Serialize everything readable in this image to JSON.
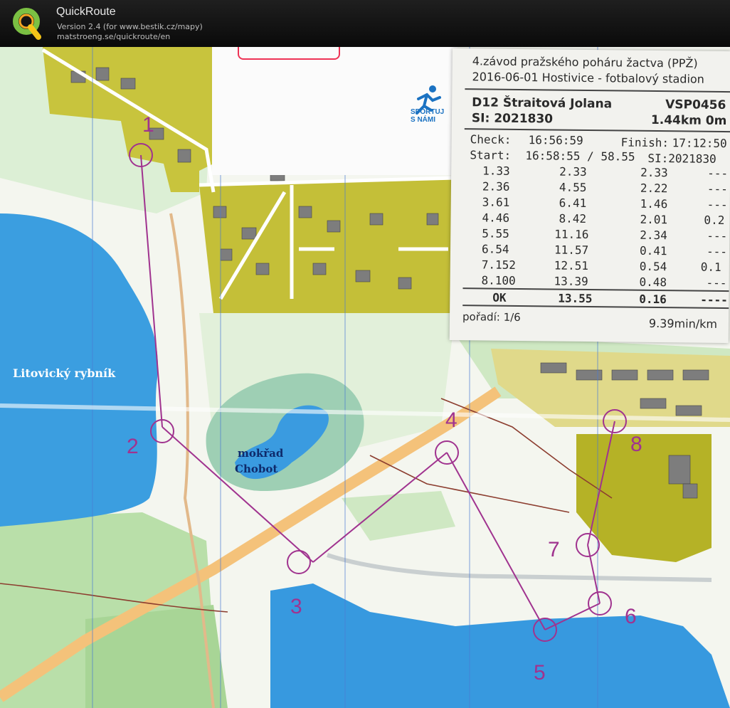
{
  "app": {
    "name": "QuickRoute",
    "version": "Version 2.4  (for www.bestik.cz/mapy)",
    "url": "matstroeng.se/quickroute/en"
  },
  "map": {
    "labels": {
      "lake": "Litovický rybník",
      "marsh_line1": "mokřad",
      "marsh_line2": "Chobot"
    },
    "controls": [
      "1",
      "2",
      "3",
      "4",
      "5",
      "6",
      "7",
      "8"
    ],
    "paper_logo": {
      "line1": "SPORTUJ",
      "line2": "S NÁMI"
    }
  },
  "receipt": {
    "event_line1": "4.závod pražského poháru žactva (PPŽ)",
    "event_line2": "2016-06-01 Hostivice - fotbalový stadion",
    "runner": "D12 Štraitová Jolana",
    "club": "VSP0456",
    "si": "SI: 2021830",
    "course": "1.44km 0m",
    "check_label": "Check:",
    "check_time": "16:56:59",
    "finish_label": "Finish:",
    "finish_time": "17:12:50",
    "start_label": "Start:",
    "start_time": "16:58:55 / 58.55",
    "start_si": "SI:2021830",
    "splits": [
      {
        "ctrl": "1.33",
        "cum": "2.33",
        "leg": "2.33",
        "extra": "---"
      },
      {
        "ctrl": "2.36",
        "cum": "4.55",
        "leg": "2.22",
        "extra": "---"
      },
      {
        "ctrl": "3.61",
        "cum": "6.41",
        "leg": "1.46",
        "extra": "---"
      },
      {
        "ctrl": "4.46",
        "cum": "8.42",
        "leg": "2.01",
        "extra": "0.2"
      },
      {
        "ctrl": "5.55",
        "cum": "11.16",
        "leg": "2.34",
        "extra": "---"
      },
      {
        "ctrl": "6.54",
        "cum": "11.57",
        "leg": "0.41",
        "extra": "---"
      },
      {
        "ctrl": "7.152",
        "cum": "12.51",
        "leg": "0.54",
        "extra": "0.1"
      },
      {
        "ctrl": "8.100",
        "cum": "13.39",
        "leg": "0.48",
        "extra": "---"
      }
    ],
    "result": {
      "status": "OK",
      "total": "13.55",
      "leg": "0.16",
      "extra": "----"
    },
    "rank": "pořadí: 1/6",
    "pace": "9.39min/km"
  }
}
